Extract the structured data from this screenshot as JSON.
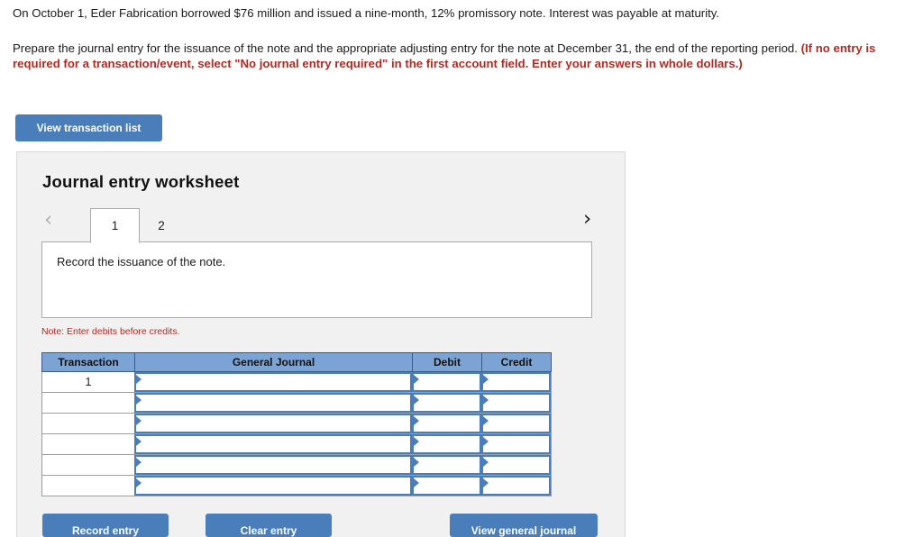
{
  "problem": {
    "paragraph1": "On October 1, Eder Fabrication borrowed $76 million and issued a nine-month, 12% promissory note. Interest was payable at maturity.",
    "paragraph2_plain": "Prepare the journal entry for the issuance of the note and the appropriate adjusting entry for the note at December 31, the end of the reporting period. ",
    "paragraph2_emphasis": "(If no entry is required for a transaction/event, select \"No journal entry required\" in the first account field. Enter your answers in whole dollars.)"
  },
  "toolbar": {
    "view_transaction_list_label": "View transaction list"
  },
  "worksheet": {
    "title": "Journal entry worksheet",
    "prev_icon": "chevron-left-icon",
    "next_icon": "chevron-right-icon",
    "prev_glyph": "‹",
    "next_glyph": "›",
    "tabs": [
      {
        "label": "1",
        "active": true
      },
      {
        "label": "2",
        "active": false
      }
    ],
    "instruction": "Record the issuance of the note.",
    "note": "Note: Enter debits before credits."
  },
  "table": {
    "headers": [
      "Transaction",
      "General Journal",
      "Debit",
      "Credit"
    ],
    "rows": [
      {
        "transaction": "1",
        "general_journal": "",
        "debit": "",
        "credit": ""
      },
      {
        "transaction": "",
        "general_journal": "",
        "debit": "",
        "credit": ""
      },
      {
        "transaction": "",
        "general_journal": "",
        "debit": "",
        "credit": ""
      },
      {
        "transaction": "",
        "general_journal": "",
        "debit": "",
        "credit": ""
      },
      {
        "transaction": "",
        "general_journal": "",
        "debit": "",
        "credit": ""
      },
      {
        "transaction": "",
        "general_journal": "",
        "debit": "",
        "credit": ""
      }
    ]
  },
  "actions": {
    "record_entry_label": "Record entry",
    "clear_entry_label": "Clear entry",
    "view_general_journal_label": "View general journal"
  },
  "colors": {
    "accent_blue": "#4a7ebb",
    "header_blue": "#7ba3d4",
    "warning_red": "#b02b23",
    "panel_gray": "#f1f1f1"
  }
}
